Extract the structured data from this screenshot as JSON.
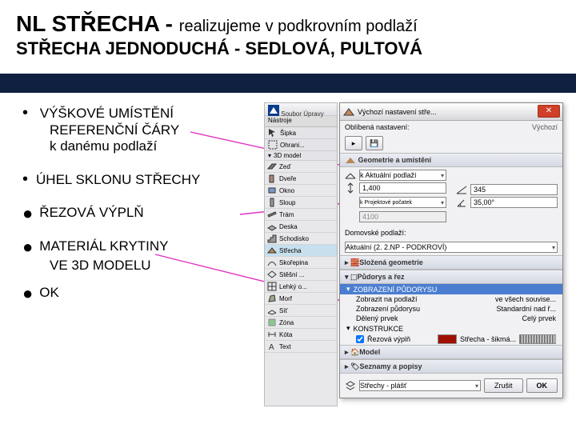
{
  "title": {
    "main": "NL STŘECHA - ",
    "sub": "realizujeme v podkrovním podlaží",
    "line2": "STŘECHA JEDNODUCHÁ - SEDLOVÁ, PULTOVÁ"
  },
  "bullets": {
    "b1a": "VÝŠKOVÉ UMÍSTĚNÍ",
    "b1b": "REFERENČNÍ ČÁRY",
    "b1c": "k danému podlaží",
    "b2": "ÚHEL SKLONU STŘECHY",
    "b3": "ŘEZOVÁ VÝPLŇ",
    "b4": "MATERIÁL KRYTINY",
    "b4b": "VE 3D MODELU",
    "b5": "OK"
  },
  "menubar": {
    "m1": "Soubor",
    "m2": "Úpravy"
  },
  "toolbar": {
    "title": "Nástroje",
    "arrow": "Šipka",
    "marquee": "Ohrani...",
    "sec3d": "3D model",
    "wall": "Zeď",
    "door": "Dveře",
    "window": "Okno",
    "column": "Sloup",
    "beam": "Trám",
    "slab": "Deska",
    "stair": "Schodisko",
    "roof": "Střecha",
    "shell": "Skořepina",
    "purlin": "Stěšní ...",
    "cw": "Lehký o...",
    "morph": "Morf",
    "mesh": "Síť",
    "zone": "Zóna",
    "dim": "Kóta",
    "text": "Text"
  },
  "dialog": {
    "title": "Výchozí nastavení stře...",
    "fav": "Oblíbená nastavení:",
    "default": "Výchozí",
    "panel_geom": "Geometrie a umístění",
    "ref_label": "k Aktuální podlaží",
    "height": "1,400",
    "floor_auto": "k Projektové počatek",
    "floor_val": "4100",
    "angle1": "345",
    "angle2": "35,00°",
    "home_floor": "Domovské podlaží:",
    "home_val": "Aktuální (2. 2.NP - PODKROVÍ)",
    "panel_comp": "Složená geometrie",
    "panel_plan": "Půdorys a řez",
    "plan_show": "ZOBRAZENÍ PŮDORYSU",
    "plan_show2": "Zobrazit na podlaží",
    "plan_show2v": "ve všech souvise...",
    "plan_disp": "Zobrazení půdorysu",
    "plan_dispv": "Standardní nad ř...",
    "plan_cut": "Dělený prvek",
    "plan_cutv": "Celý prvek",
    "constr": "KONSTRUKCE",
    "fill": "Řezová výplň",
    "fill_val": "Střecha - šikmá...",
    "panel_model": "Model",
    "panel_tags": "Seznamy a popisy",
    "layer_combo": "Střechy - plášť",
    "cancel": "Zrušit",
    "ok": "OK"
  }
}
